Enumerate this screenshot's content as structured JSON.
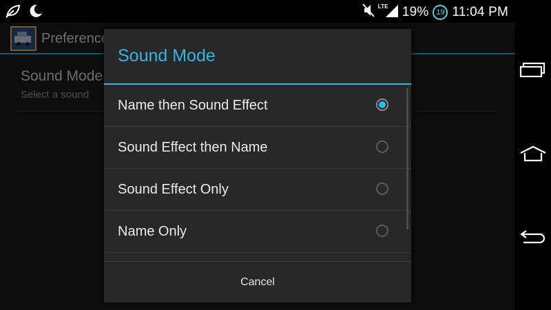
{
  "status_bar": {
    "lte_label": "LTE",
    "battery_percent": "19%",
    "notification_badge": "19",
    "time": "11:04 PM",
    "icons": [
      "leaf-icon",
      "moon-icon",
      "mute-icon",
      "signal-icon"
    ]
  },
  "app": {
    "title": "Preference",
    "preference": {
      "title": "Sound Mode",
      "summary": "Select a sound"
    }
  },
  "dialog": {
    "title": "Sound Mode",
    "options": [
      {
        "label": "Name then Sound Effect",
        "selected": true
      },
      {
        "label": "Sound Effect then Name",
        "selected": false
      },
      {
        "label": "Sound Effect Only",
        "selected": false
      },
      {
        "label": "Name Only",
        "selected": false
      }
    ],
    "cancel_label": "Cancel"
  },
  "nav_bar": {
    "buttons": [
      "recent-apps-icon",
      "home-icon",
      "back-icon"
    ]
  },
  "colors": {
    "accent": "#33b5e5",
    "dialog_bg": "#282828",
    "app_bg": "#1a1a1a"
  }
}
